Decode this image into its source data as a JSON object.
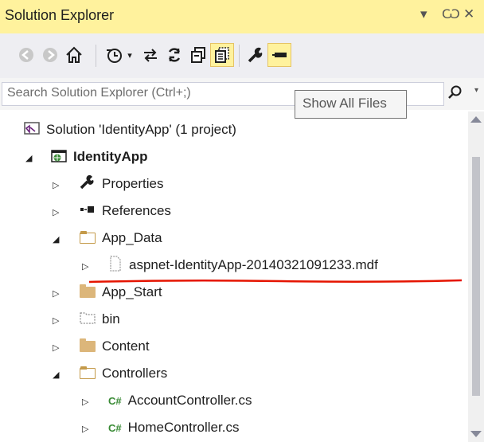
{
  "window": {
    "title": "Solution Explorer",
    "pin_glyph": "↓ Ѡ",
    "dropdown_glyph": "▾",
    "pin_label": "Ѡ",
    "close_label": "✕"
  },
  "toolbar": {
    "buttons": [
      {
        "icon": "back-icon",
        "glyph": "◀"
      },
      {
        "icon": "forward-icon",
        "glyph": "▶"
      },
      {
        "icon": "home-icon",
        "glyph": "⌂"
      },
      {
        "icon": "history-icon",
        "glyph": "↺"
      },
      {
        "icon": "sync-icon",
        "glyph": "⇄"
      },
      {
        "icon": "refresh-icon",
        "glyph": "⟳"
      },
      {
        "icon": "collapse-all-icon",
        "glyph": "▣"
      },
      {
        "icon": "show-all-files-icon",
        "glyph": "▤"
      },
      {
        "icon": "properties-icon",
        "glyph": "⚒"
      },
      {
        "icon": "preview-icon",
        "glyph": "▬"
      }
    ]
  },
  "search": {
    "placeholder": "Search Solution Explorer (Ctrl+;)"
  },
  "tooltip": {
    "text": "Show All Files"
  },
  "tree": {
    "items": [
      {
        "label": "Solution 'IdentityApp' (1 project)",
        "icon": "solution-icon",
        "expander": ""
      },
      {
        "label": "IdentityApp",
        "icon": "web-project-icon",
        "expander": "◢",
        "bold": true
      },
      {
        "label": "Properties",
        "icon": "wrench-icon",
        "expander": "▷"
      },
      {
        "label": "References",
        "icon": "references-icon",
        "expander": "▷"
      },
      {
        "label": "App_Data",
        "icon": "folder-open-icon",
        "expander": "◢"
      },
      {
        "label": "aspnet-IdentityApp-20140321091233.mdf",
        "icon": "file-icon",
        "expander": "▷"
      },
      {
        "label": "App_Start",
        "icon": "folder-icon",
        "expander": "▷"
      },
      {
        "label": "bin",
        "icon": "hidden-folder-icon",
        "expander": "▷"
      },
      {
        "label": "Content",
        "icon": "folder-icon",
        "expander": "▷"
      },
      {
        "label": "Controllers",
        "icon": "folder-open-icon",
        "expander": "◢"
      },
      {
        "label": "AccountController.cs",
        "icon": "csharp-file-icon",
        "expander": "▷"
      },
      {
        "label": "HomeController.cs",
        "icon": "csharp-file-icon",
        "expander": "▷"
      }
    ]
  },
  "colors": {
    "title_bg": "#fff29d",
    "toolbar_bg": "#eeeef2",
    "annotation_red": "#e51400"
  }
}
